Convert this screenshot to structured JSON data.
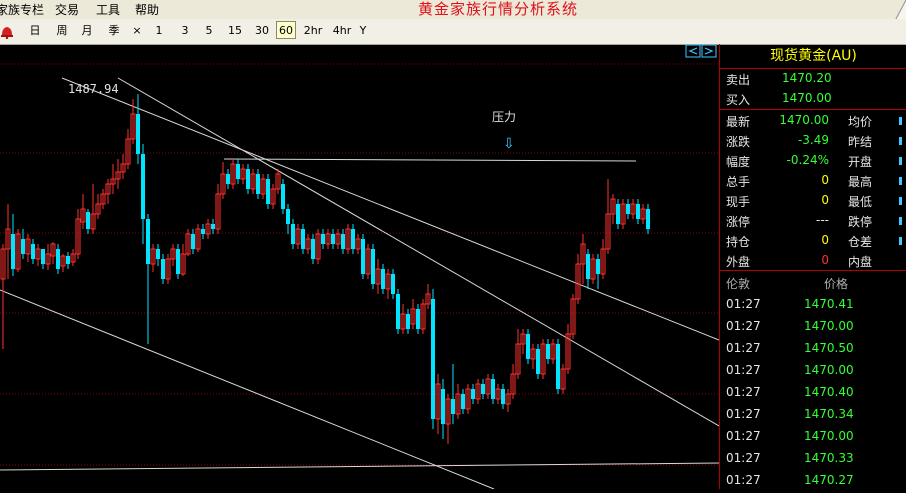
{
  "menu": {
    "items": [
      "家族专栏",
      "交易",
      "工具",
      "帮助"
    ],
    "app_title": "黄金家族行情分析系统"
  },
  "toolbar": {
    "periods": [
      "日",
      "周",
      "月",
      "季",
      "×",
      "1",
      "3",
      "5",
      "15",
      "30",
      "60",
      "2hr",
      "4hr",
      "Y"
    ],
    "active": "60"
  },
  "chart": {
    "high_label": "1487.94",
    "annotation": "压力",
    "arrow": "⇩",
    "nav_icons": [
      "scroll-left-icon",
      "scroll-right-icon"
    ]
  },
  "panel": {
    "title": "现货黄金(AU)",
    "sell": {
      "label": "卖出",
      "value": "1470.20"
    },
    "buy": {
      "label": "买入",
      "value": "1470.00"
    },
    "rows": [
      {
        "label": "最新",
        "value": "1470.00",
        "color": "#35ff35",
        "label2": "均价"
      },
      {
        "label": "涨跌",
        "value": "-3.49",
        "color": "#35ff35",
        "label2": "昨结"
      },
      {
        "label": "幅度",
        "value": "-0.24%",
        "color": "#35ff35",
        "label2": "开盘"
      },
      {
        "label": "总手",
        "value": "0",
        "color": "#ffff00",
        "label2": "最高"
      },
      {
        "label": "现手",
        "value": "0",
        "color": "#ffff00",
        "label2": "最低"
      },
      {
        "label": "涨停",
        "value": "---",
        "color": "#e6e6e6",
        "label2": "跌停"
      },
      {
        "label": "持仓",
        "value": "0",
        "color": "#ffff00",
        "label2": "仓差"
      },
      {
        "label": "外盘",
        "value": "0",
        "color": "#ff3030",
        "label2": "内盘"
      }
    ],
    "trades_header": {
      "time": "伦敦",
      "price": "价格"
    },
    "trades": [
      {
        "time": "01:27",
        "price": "1470.41"
      },
      {
        "time": "01:27",
        "price": "1470.00"
      },
      {
        "time": "01:27",
        "price": "1470.50"
      },
      {
        "time": "01:27",
        "price": "1470.00"
      },
      {
        "time": "01:27",
        "price": "1470.40"
      },
      {
        "time": "01:27",
        "price": "1470.34"
      },
      {
        "time": "01:27",
        "price": "1470.00"
      },
      {
        "time": "01:27",
        "price": "1470.33"
      },
      {
        "time": "01:27",
        "price": "1470.27"
      }
    ]
  },
  "colors": {
    "up": "#ff3030",
    "down": "#00e5ff",
    "grid": "#8a0000",
    "line": "#d8d8d8"
  }
}
